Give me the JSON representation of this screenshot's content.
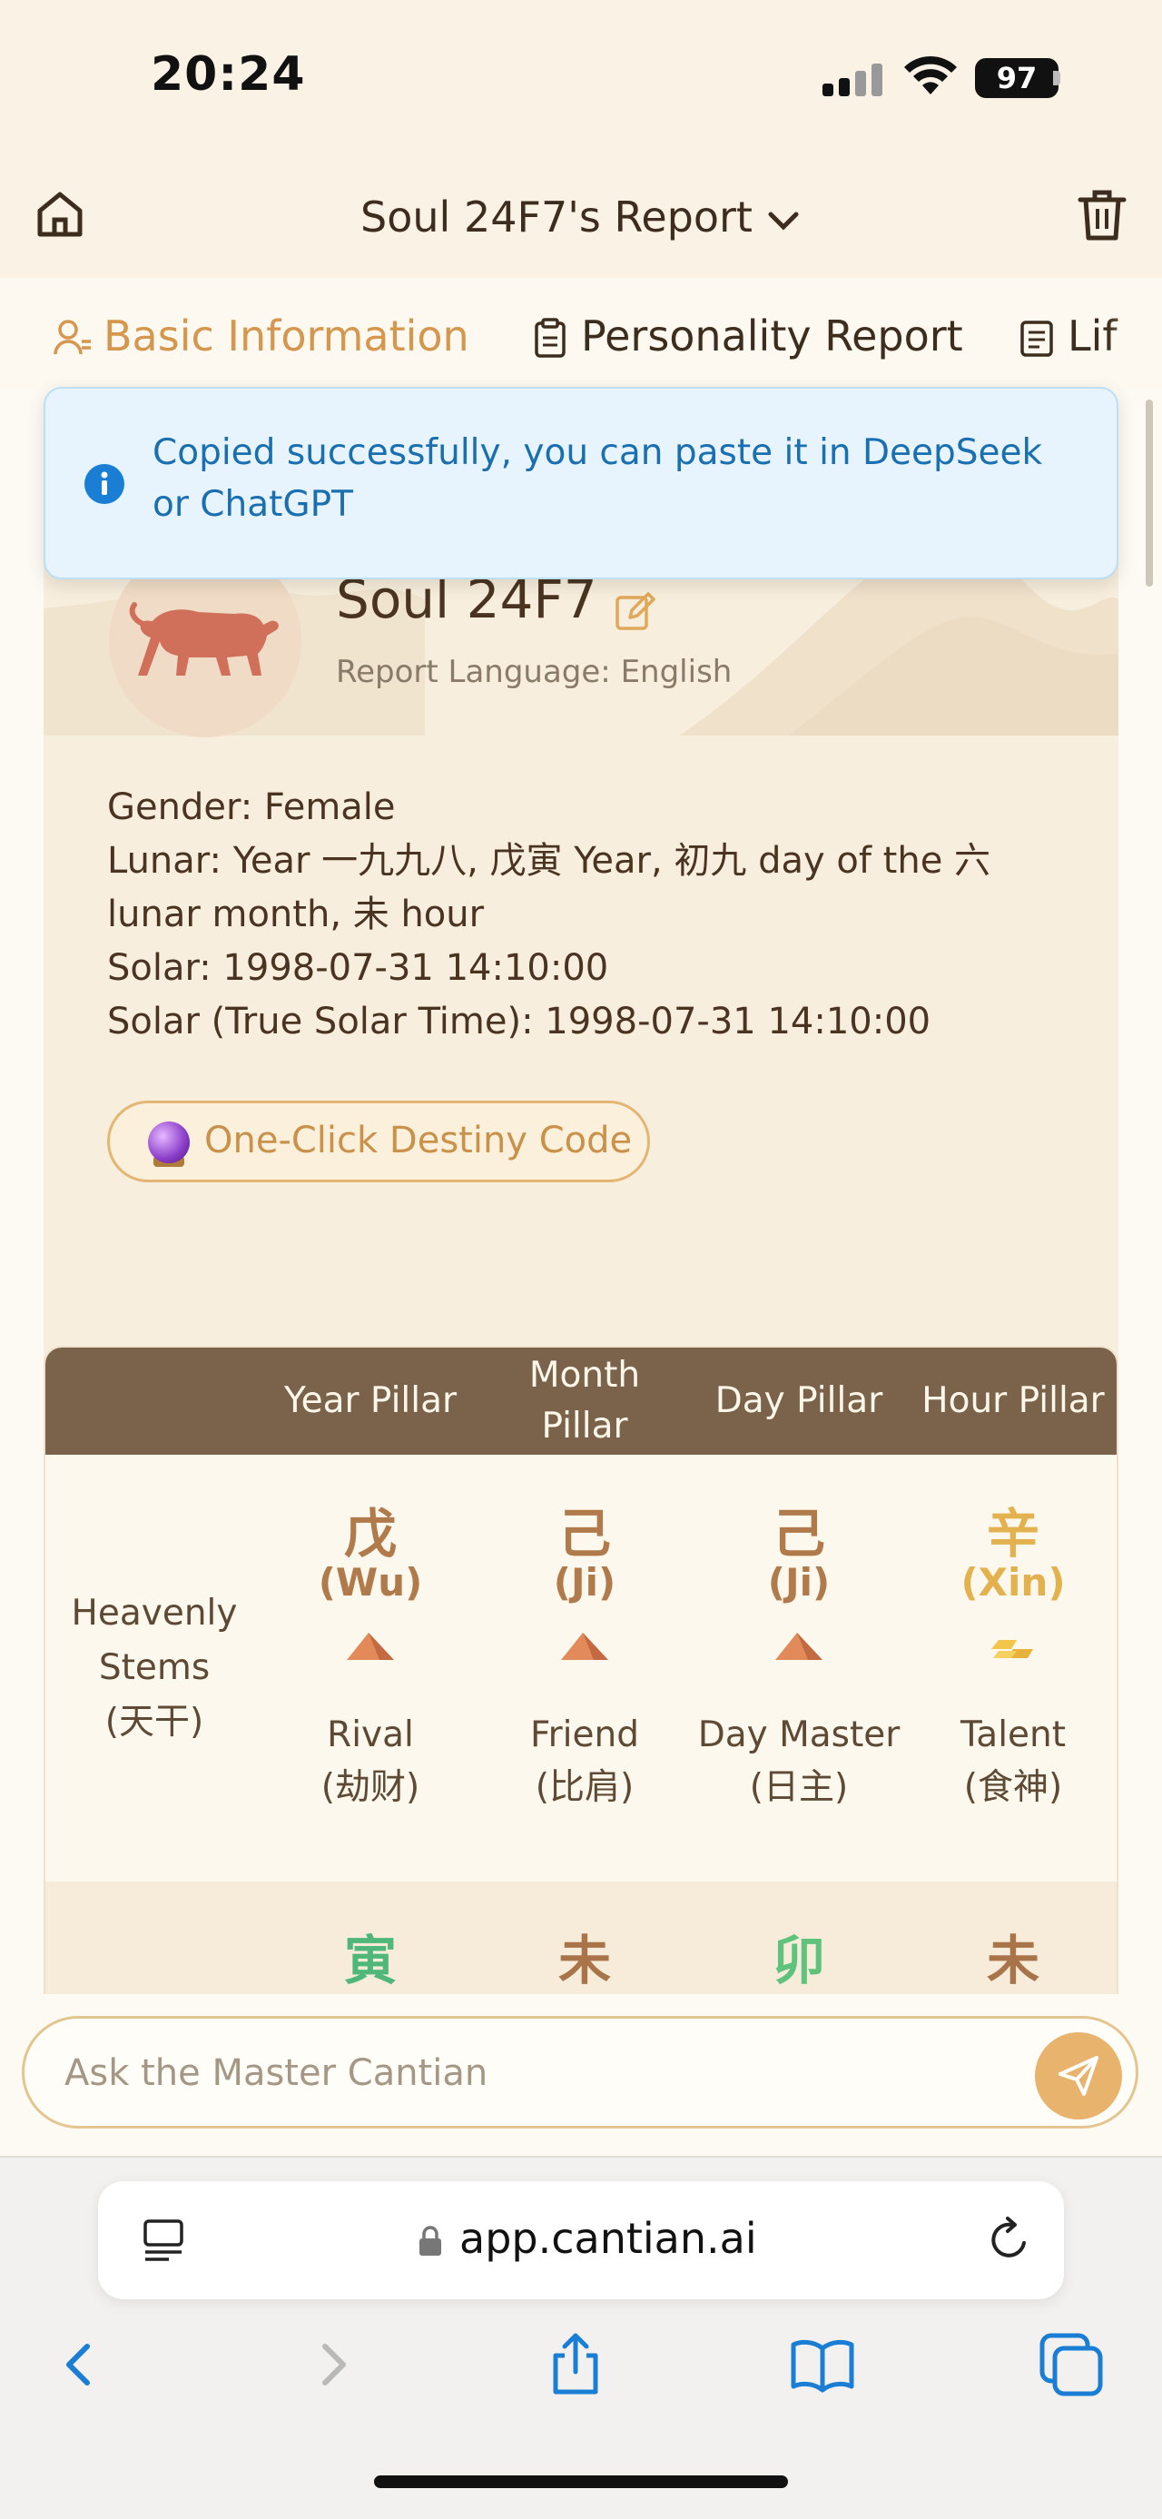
{
  "status_bar": {
    "time": "20:24",
    "battery": "97"
  },
  "header": {
    "title": "Soul 24F7's Report"
  },
  "tabs": [
    {
      "label": "Basic Information",
      "active": true
    },
    {
      "label": "Personality Report",
      "active": false
    },
    {
      "label": "Lif",
      "active": false
    }
  ],
  "toast": {
    "message": "Copied successfully, you can paste it in DeepSeek or ChatGPT"
  },
  "profile": {
    "name": "Soul 24F7",
    "report_language": "Report Language: English",
    "zodiac_icon": "tiger-icon",
    "gender": "Gender: Female",
    "lunar_line1": "Lunar: Year 一九九八, 戊寅 Year, 初九 day of the 六",
    "lunar_line2": "lunar month, 未 hour",
    "solar": "Solar: 1998-07-31 14:10:00",
    "solar_true": "Solar (True Solar Time): 1998-07-31 14:10:00",
    "destiny_button": "One-Click Destiny Code"
  },
  "pillars": {
    "headers": [
      "Year Pillar",
      "Month\nPillar",
      "Day Pillar",
      "Hour Pillar"
    ],
    "stems_label": "Heavenly\nStems\n(天干)",
    "stems": [
      {
        "char": "戊",
        "pinyin": "(Wu)",
        "role": "Rival\n(劫财)",
        "color": "#b07a4a",
        "element": "earth-icon"
      },
      {
        "char": "己",
        "pinyin": "(Ji)",
        "role": "Friend\n(比肩)",
        "color": "#b07a4a",
        "element": "earth-icon"
      },
      {
        "char": "己",
        "pinyin": "(Ji)",
        "role": "Day Master\n(日主)",
        "color": "#b07a4a",
        "element": "earth-icon"
      },
      {
        "char": "辛",
        "pinyin": "(Xin)",
        "role": "Talent\n(食神)",
        "color": "#e3b24e",
        "element": "gold-icon"
      }
    ],
    "branches": [
      {
        "char": "寅",
        "color": "#4fb77a"
      },
      {
        "char": "未",
        "color": "#a9744a"
      },
      {
        "char": "卯",
        "color": "#5fc37e"
      },
      {
        "char": "未",
        "color": "#a9744a"
      }
    ]
  },
  "ask": {
    "placeholder": "Ask the Master Cantian"
  },
  "browser": {
    "url": "app.cantian.ai"
  },
  "colors": {
    "accent": "#d4974d",
    "header_brown": "#7a634a",
    "toast_text": "#1a6fb0"
  }
}
